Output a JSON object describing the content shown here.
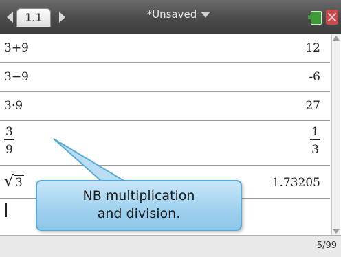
{
  "topbar": {
    "tab_label": "1.1",
    "doc_title": "*Unsaved"
  },
  "rows": [
    {
      "expr": "3+9",
      "result": "12"
    },
    {
      "expr": "3−9",
      "result": "-6"
    },
    {
      "expr": "3·9",
      "result": "27"
    },
    {
      "expr_num": "3",
      "expr_den": "9",
      "result_num": "1",
      "result_den": "3"
    },
    {
      "expr_radicand": "3",
      "result": "1.73205"
    }
  ],
  "callout": {
    "text": "NB multiplication\nand division."
  },
  "status": {
    "count": "5/99"
  },
  "colors": {
    "topbar": "#4a4a4a",
    "callout_fill": "#9fd1ef",
    "callout_border": "#5aa8d6"
  }
}
